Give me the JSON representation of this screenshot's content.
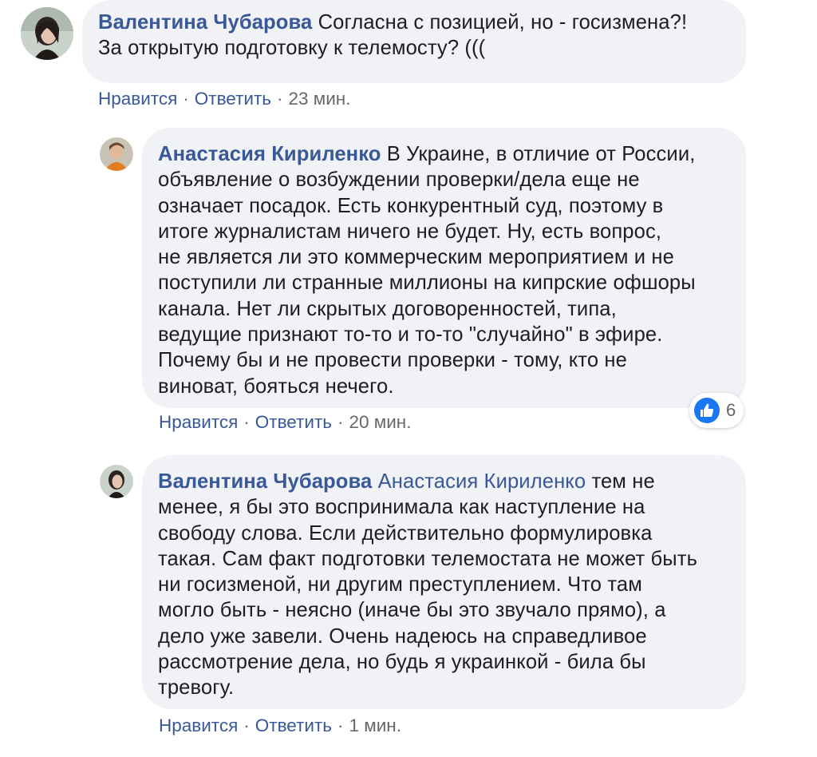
{
  "comments": [
    {
      "author": "Валентина Чубарова",
      "mention": "",
      "lines": [
        "Согласна с позицией, но - госизмена?!",
        "За открытую подготовку к телемосту? ((("
      ],
      "actions": {
        "like": "Нравится",
        "reply": "Ответить",
        "time": "23 мин."
      }
    },
    {
      "author": "Анастасия Кириленко",
      "mention": "",
      "lines": [
        "В Украине, в отличие от России,",
        "объявление о возбуждении проверки/дела еще не",
        "означает посадок. Есть конкурентный суд, поэтому в",
        "итоге журналистам ничего не будет. Ну, есть вопрос,",
        "не является ли это коммерческим мероприятием и не",
        "поступили ли странные миллионы на кипрские офшоры",
        "канала. Нет ли скрытых договоренностей, типа,",
        "ведущие признают то-то и то-то \"случайно\" в эфире.",
        "Почему бы и не провести проверки - тому, кто не",
        "виноват, бояться нечего."
      ],
      "actions": {
        "like": "Нравится",
        "reply": "Ответить",
        "time": "20 мин."
      },
      "reactions": {
        "icon": "like-thumb-icon",
        "count": "6"
      }
    },
    {
      "author": "Валентина Чубарова",
      "mention": "Анастасия Кириленко",
      "lines": [
        "тем не",
        "менее, я бы это воспринимала как наступление на",
        "свободу слова. Если действительно формулировка",
        "такая. Сам факт подготовки телемостата не может быть",
        "ни госизменой, ни другим преступлением. Что там",
        "могло быть - неясно (иначе бы это звучало прямо), а",
        "дело уже завели. Очень надеюсь на справедливое",
        "рассмотрение дела, но будь я украинкой - била бы",
        "тревогу."
      ],
      "actions": {
        "like": "Нравится",
        "reply": "Ответить",
        "time": "1 мин."
      }
    }
  ],
  "colors": {
    "bubble_bg": "#f0f2f5",
    "author": "#385898",
    "meta": "#65676b",
    "like_blue": "#1877f2"
  }
}
